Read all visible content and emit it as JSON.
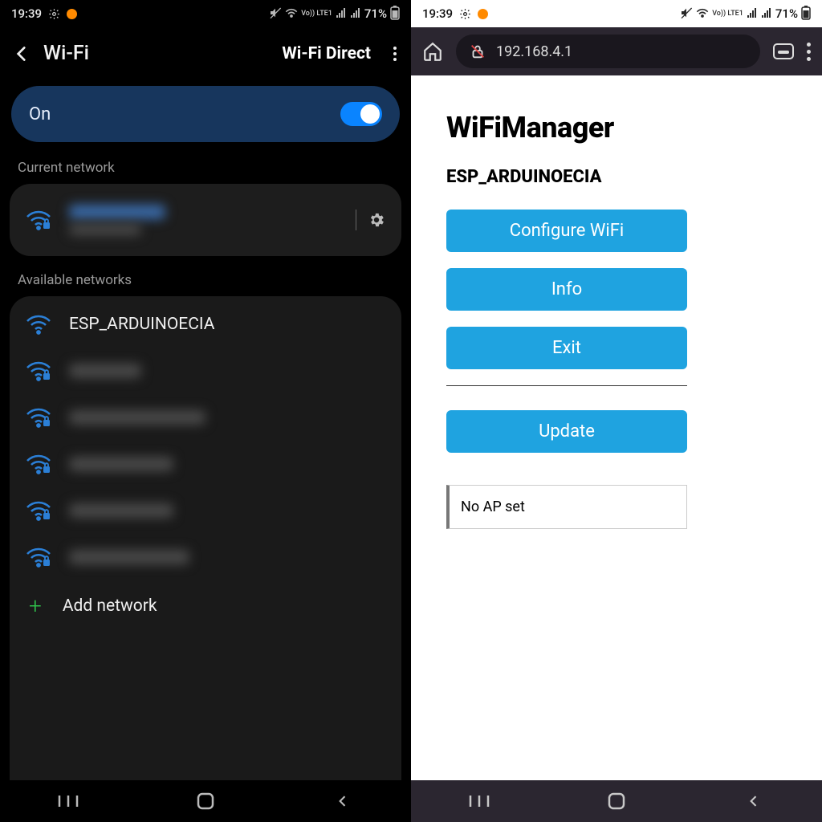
{
  "status": {
    "time": "19:39",
    "battery": "71%",
    "lte_label": "Vo)) LTE1"
  },
  "left": {
    "header": {
      "title": "Wi-Fi",
      "direct": "Wi-Fi Direct"
    },
    "toggle_label": "On",
    "section_current": "Current network",
    "section_available": "Available networks",
    "current_network": {
      "name_hidden": true,
      "subtitle_hidden": true
    },
    "networks": [
      {
        "name": "ESP_ARDUINOECIA",
        "locked": false,
        "blurred": false
      },
      {
        "blurred": true,
        "width": "w1",
        "locked": true
      },
      {
        "blurred": true,
        "width": "w3",
        "locked": true
      },
      {
        "blurred": true,
        "width": "w2",
        "locked": true
      },
      {
        "blurred": true,
        "width": "w2",
        "locked": true
      },
      {
        "blurred": true,
        "width": "w4",
        "locked": true
      }
    ],
    "add_network": "Add network"
  },
  "right": {
    "url": "192.168.4.1",
    "page": {
      "title": "WiFiManager",
      "ssid": "ESP_ARDUINOECIA",
      "btn_configure": "Configure WiFi",
      "btn_info": "Info",
      "btn_exit": "Exit",
      "btn_update": "Update",
      "status_msg": "No AP set"
    }
  }
}
